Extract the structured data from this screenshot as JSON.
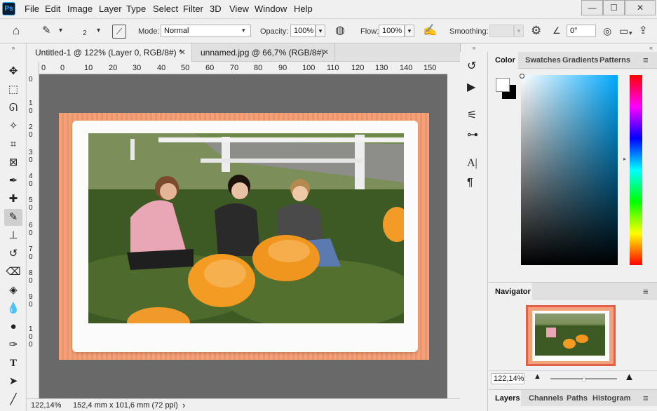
{
  "app": {
    "logo": "Ps"
  },
  "menu": [
    "File",
    "Edit",
    "Image",
    "Layer",
    "Type",
    "Select",
    "Filter",
    "3D",
    "View",
    "Window",
    "Help"
  ],
  "window_controls": {
    "minimize": "—",
    "restore": "☐",
    "close": "✕"
  },
  "options": {
    "brush_size": "2",
    "mode_label": "Mode:",
    "mode_value": "Normal",
    "opacity_label": "Opacity:",
    "opacity_value": "100%",
    "flow_label": "Flow:",
    "flow_value": "100%",
    "smoothing_label": "Smoothing:",
    "smoothing_value": "",
    "angle_value": "0°"
  },
  "tabs": [
    {
      "label": "Untitled-1 @ 122% (Layer 0, RGB/8#) *",
      "active": true
    },
    {
      "label": "unnamed.jpg @ 66,7% (RGB/8#)",
      "active": false
    }
  ],
  "ruler": {
    "h": [
      "0",
      "0",
      "10",
      "20",
      "30",
      "40",
      "50",
      "60",
      "70",
      "80",
      "90",
      "100",
      "110",
      "120",
      "130",
      "140",
      "150"
    ],
    "v": [
      "0",
      "10",
      "20",
      "30",
      "40",
      "50",
      "60",
      "70",
      "80",
      "90",
      "100"
    ]
  },
  "status": {
    "zoom": "122,14%",
    "doc_size": "152,4 mm x 101,6 mm (72 ppi)",
    "arrow": "›"
  },
  "panels": {
    "color_tabs": [
      "Color",
      "Swatches",
      "Gradients",
      "Patterns"
    ],
    "navigator_title": "Navigator",
    "navigator_zoom": "122,14%",
    "bottom_tabs": [
      "Layers",
      "Channels",
      "Paths",
      "Histogram"
    ]
  },
  "colors": {
    "accent": "#31a8ff",
    "frame": "#f0a078",
    "nav_border": "#e2604a"
  }
}
